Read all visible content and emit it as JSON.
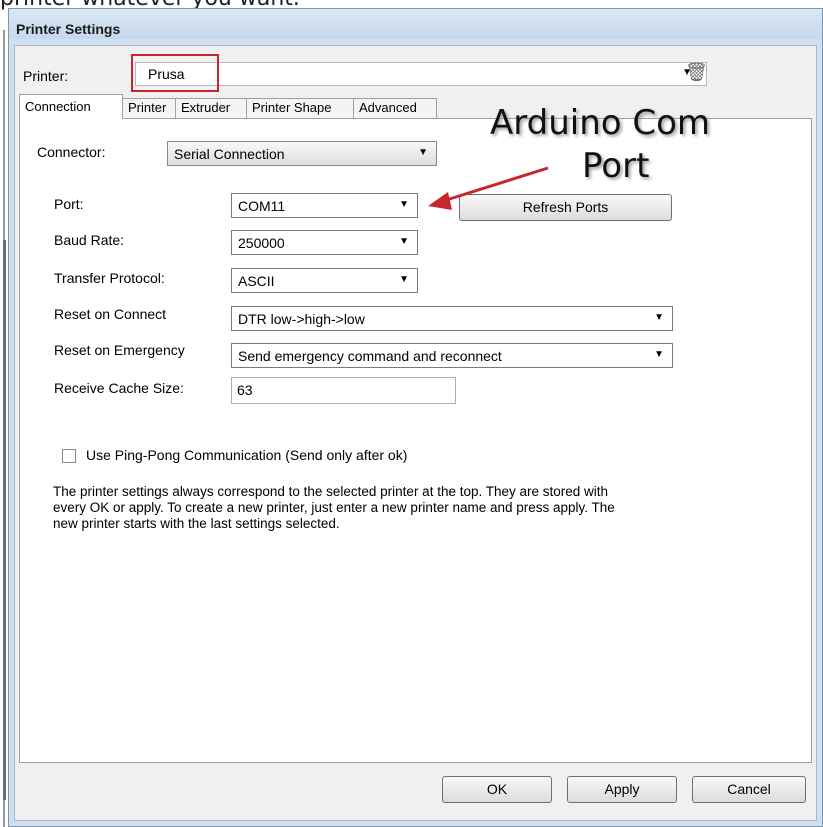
{
  "caption": "printer whatever you want.",
  "window": {
    "title": "Printer Settings"
  },
  "printer": {
    "label": "Printer:",
    "value": "Prusa",
    "delete_icon": "trash-icon"
  },
  "tabs": [
    {
      "label": "Connection",
      "active": true
    },
    {
      "label": "Printer",
      "active": false
    },
    {
      "label": "Extruder",
      "active": false
    },
    {
      "label": "Printer Shape",
      "active": false
    },
    {
      "label": "Advanced",
      "active": false
    }
  ],
  "connection": {
    "connector_label": "Connector:",
    "connector_value": "Serial Connection",
    "port_label": "Port:",
    "port_value": "COM11",
    "refresh_label": "Refresh Ports",
    "baud_label": "Baud Rate:",
    "baud_value": "250000",
    "protocol_label": "Transfer Protocol:",
    "protocol_value": "ASCII",
    "reset_connect_label": "Reset on Connect",
    "reset_connect_value": "DTR low->high->low",
    "reset_emergency_label": "Reset on Emergency",
    "reset_emergency_value": "Send emergency command and reconnect",
    "cache_label": "Receive Cache Size:",
    "cache_value": "63",
    "pingpong_label": "Use Ping-Pong Communication (Send only after ok)",
    "pingpong_checked": false,
    "info_text": "The printer settings always correspond to the selected printer at the top. They are stored with every OK or apply. To create a new printer, just enter a new printer name and press apply. The new printer starts with the last settings selected."
  },
  "annotation": {
    "line1": "Arduino Com",
    "line2": "Port",
    "color": "#c6262e"
  },
  "buttons": {
    "ok": "OK",
    "apply": "Apply",
    "cancel": "Cancel"
  },
  "colors": {
    "highlight": "#c6262e",
    "window_frame": "#cfe0f1"
  }
}
